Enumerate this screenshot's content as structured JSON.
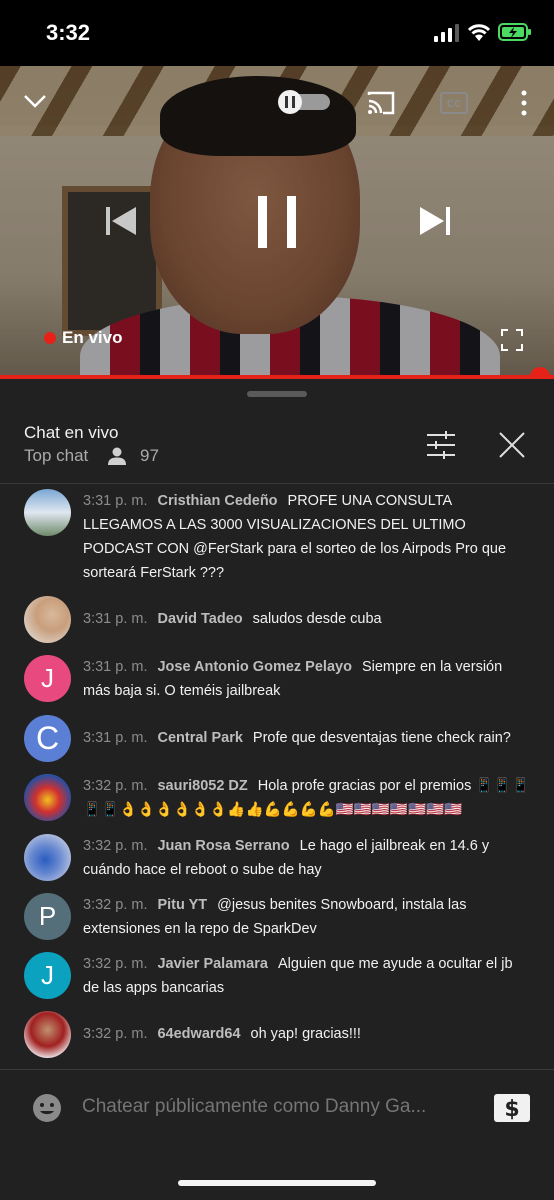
{
  "status_bar": {
    "time": "3:32"
  },
  "player": {
    "live_label": "En vivo"
  },
  "chat": {
    "title": "Chat en vivo",
    "mode": "Top chat",
    "viewer_count": "97",
    "input_placeholder": "Chatear públicamente como Danny Ga...",
    "messages": [
      {
        "time": "3:31 p. m.",
        "author": "Cristhian Cedeño",
        "text": "PROFE UNA CONSULTA LLEGAMOS A LAS 3000 VISUALIZACIONES DEL ULTIMO PODCAST CON @FerStark para el sorteo de los Airpods Pro que sorteará FerStark ???",
        "avatar": "photo"
      },
      {
        "time": "3:31 p. m.",
        "author": "David Tadeo",
        "text": "saludos desde cuba",
        "avatar": "photo"
      },
      {
        "time": "3:31 p. m.",
        "author": "Jose Antonio Gomez Pelayo",
        "text": "Siempre en la versión más baja si. O teméis jailbreak",
        "avatar": "J"
      },
      {
        "time": "3:31 p. m.",
        "author": "Central Park",
        "text": "Profe que desventajas tiene check rain?",
        "avatar": "C"
      },
      {
        "time": "3:32 p. m.",
        "author": "sauri8052 DZ",
        "text": "Hola profe gracias por el premios 📱📱📱📱📱👌👌👌👌👌👌👍👍💪💪💪💪🇺🇸🇺🇸🇺🇸🇺🇸🇺🇸🇺🇸🇺🇸",
        "avatar": "photo"
      },
      {
        "time": "3:32 p. m.",
        "author": "Juan Rosa Serrano",
        "text": "Le hago el jailbreak en 14.6 y cuándo hace el reboot o sube de hay",
        "avatar": "photo"
      },
      {
        "time": "3:32 p. m.",
        "author": "Pitu YT",
        "text": "@jesus benites Snowboard, instala las extensiones en la repo de SparkDev",
        "avatar": "P"
      },
      {
        "time": "3:32 p. m.",
        "author": "Javier Palamara",
        "text": "Alguien que me ayude a ocultar el jb de las apps bancarias",
        "avatar": "J"
      },
      {
        "time": "3:32 p. m.",
        "author": "64edward64",
        "text": "oh yap! gracias!!!",
        "avatar": "photo"
      }
    ]
  },
  "colors": {
    "accent": "#e62117",
    "panel_bg": "#212121",
    "avatar_pink": "#e84a7f",
    "avatar_blue": "#5c7fd6",
    "avatar_slate": "#546e7a",
    "avatar_teal": "#0aa2bf"
  },
  "icons": [
    "chevron-down-icon",
    "autoplay-toggle-icon",
    "cast-icon",
    "cc-icon",
    "more-icon",
    "previous-icon",
    "pause-icon",
    "next-icon",
    "fullscreen-icon",
    "person-icon",
    "filter-icon",
    "close-icon",
    "emoji-icon",
    "super-chat-icon"
  ]
}
